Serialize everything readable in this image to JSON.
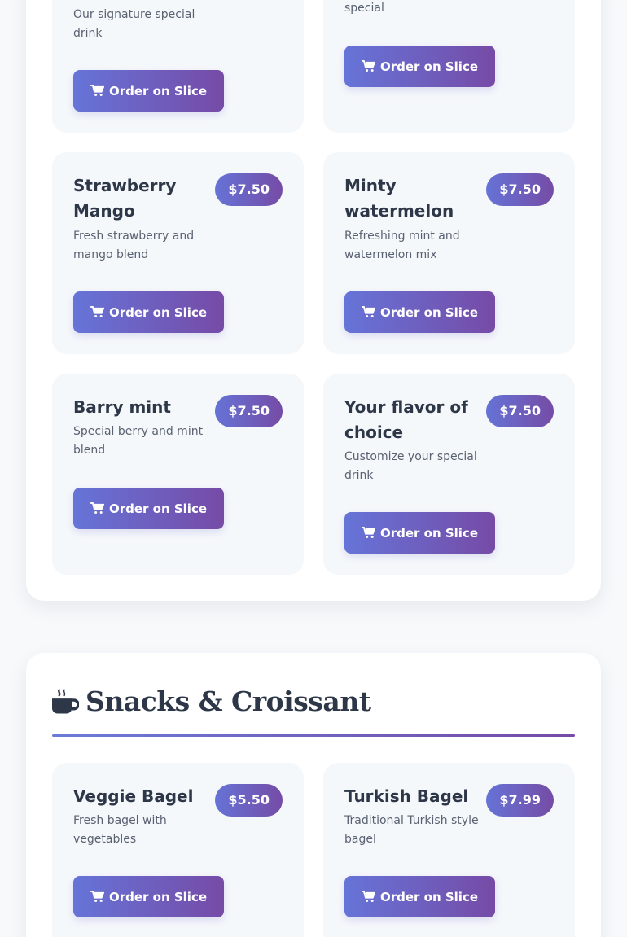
{
  "order_label": "Order on Slice",
  "drinks_section": {
    "items": [
      {
        "desc": "Our signature special drink"
      },
      {
        "desc": "special"
      },
      {
        "name": "Strawberry Mango",
        "price": "$7.50",
        "desc": "Fresh strawberry and mango blend"
      },
      {
        "name": "Minty watermelon",
        "price": "$7.50",
        "desc": "Refreshing mint and watermelon mix"
      },
      {
        "name": "Barry mint",
        "price": "$7.50",
        "desc": "Special berry and mint blend"
      },
      {
        "name": "Your flavor of choice",
        "price": "$7.50",
        "desc": "Customize your special drink"
      }
    ]
  },
  "snacks_section": {
    "title": "Snacks & Croissant",
    "icon": "coffee-cup-icon",
    "items": [
      {
        "name": "Veggie Bagel",
        "price": "$5.50",
        "desc": "Fresh bagel with vegetables"
      },
      {
        "name": "Turkish Bagel",
        "price": "$7.99",
        "desc": "Traditional Turkish style bagel"
      }
    ]
  },
  "colors": {
    "accent_start": "#6674d8",
    "accent_end": "#764ba6",
    "card_bg": "#f5f8fb"
  }
}
